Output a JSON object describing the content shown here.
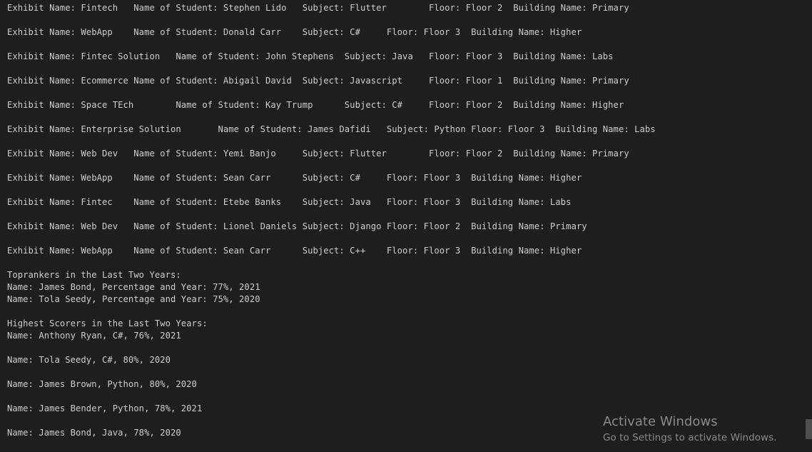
{
  "terminal": {
    "lines": [
      "Exhibit Name: Fintech   Name of Student: Stephen Lido   Subject: Flutter        Floor: Floor 2  Building Name: Primary",
      "Exhibit Name: WebApp    Name of Student: Donald Carr    Subject: C#     Floor: Floor 3  Building Name: Higher",
      "Exhibit Name: Fintec Solution   Name of Student: John Stephens  Subject: Java   Floor: Floor 3  Building Name: Labs",
      "Exhibit Name: Ecommerce Name of Student: Abigail David  Subject: Javascript     Floor: Floor 1  Building Name: Primary",
      "Exhibit Name: Space TEch        Name of Student: Kay Trump      Subject: C#     Floor: Floor 2  Building Name: Higher",
      "Exhibit Name: Enterprise Solution       Name of Student: James Dafidi   Subject: Python Floor: Floor 3  Building Name: Labs",
      "Exhibit Name: Web Dev   Name of Student: Yemi Banjo     Subject: Flutter        Floor: Floor 2  Building Name: Primary",
      "Exhibit Name: WebApp    Name of Student: Sean Carr      Subject: C#     Floor: Floor 3  Building Name: Higher",
      "Exhibit Name: Fintec    Name of Student: Etebe Banks    Subject: Java   Floor: Floor 3  Building Name: Labs",
      "Exhibit Name: Web Dev   Name of Student: Lionel Daniels Subject: Django Floor: Floor 2  Building Name: Primary",
      "Exhibit Name: WebApp    Name of Student: Sean Carr      Subject: C++    Floor: Floor 3  Building Name: Higher",
      "Toprankers in the Last Two Years:",
      "Name: James Bond, Percentage and Year: 77%, 2021",
      "Name: Tola Seedy, Percentage and Year: 75%, 2020",
      "Highest Scorers in the Last Two Years:",
      "Name: Anthony Ryan, C#, 76%, 2021",
      "Name: Tola Seedy, C#, 80%, 2020",
      "Name: James Brown, Python, 80%, 2020",
      "Name: James Bender, Python, 78%, 2021",
      "Name: James Bond, Java, 78%, 2020"
    ]
  },
  "watermark": {
    "title": "Activate Windows",
    "subtitle": "Go to Settings to activate Windows."
  }
}
